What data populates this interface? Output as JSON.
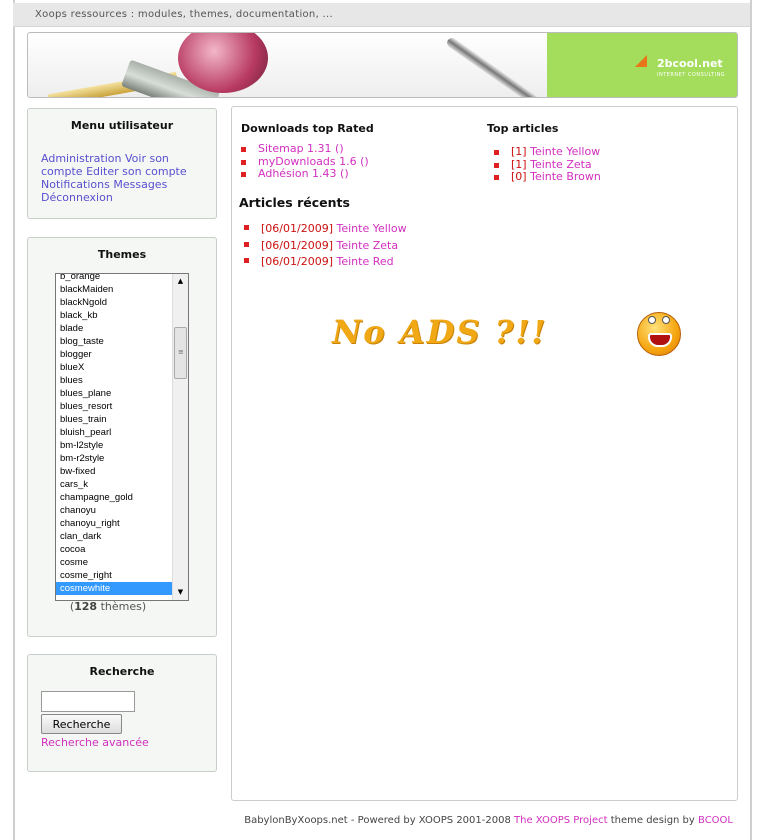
{
  "topbar": {
    "text": "Xoops ressources : modules, themes, documentation, ..."
  },
  "banner": {
    "brand": "2bcool.net",
    "tagline": "INTERNET CONSULTING"
  },
  "user_menu": {
    "title": "Menu utilisateur",
    "links": [
      "Administration",
      "Voir son compte",
      "Editer son compte",
      "Notifications",
      "Messages",
      "Déconnexion"
    ]
  },
  "themes": {
    "title": "Themes",
    "items": [
      "b_orange",
      "blackMaiden",
      "blackNgold",
      "black_kb",
      "blade",
      "blog_taste",
      "blogger",
      "blueX",
      "blues",
      "blues_plane",
      "blues_resort",
      "blues_train",
      "bluish_pearl",
      "bm-l2style",
      "bm-r2style",
      "bw-fixed",
      "cars_k",
      "champagne_gold",
      "chanoyu",
      "chanoyu_right",
      "clan_dark",
      "cocoa",
      "cosme",
      "cosme_right",
      "cosmewhite"
    ],
    "selected": "cosmewhite",
    "count": "128",
    "count_suffix": "thèmes"
  },
  "search": {
    "title": "Recherche",
    "button": "Recherche",
    "advanced": "Recherche avancée",
    "value": ""
  },
  "downloads": {
    "title": "Downloads top Rated",
    "items": [
      {
        "name": "Sitemap 1.31",
        "suffix": "()"
      },
      {
        "name": "myDownloads 1.6",
        "suffix": "()"
      },
      {
        "name": "Adhésion 1.43",
        "suffix": "()"
      }
    ]
  },
  "top_articles": {
    "title": "Top articles",
    "items": [
      {
        "tag": "[1]",
        "name": "Teinte Yellow"
      },
      {
        "tag": "[1]",
        "name": "Teinte Zeta"
      },
      {
        "tag": "[0]",
        "name": "Teinte Brown"
      }
    ]
  },
  "recent_articles": {
    "title": "Articles récents",
    "items": [
      {
        "date": "[06/01/2009]",
        "name": "Teinte Yellow"
      },
      {
        "date": "[06/01/2009]",
        "name": "Teinte Zeta"
      },
      {
        "date": "[06/01/2009]",
        "name": "Teinte Red"
      }
    ]
  },
  "ad": {
    "text": "No ADS ?!!"
  },
  "footer": {
    "text": "BabylonByXoops.net - Powered by XOOPS 2001-2008",
    "link1": "The XOOPS Project",
    "mid": "theme design by",
    "link2": "BCOOL"
  },
  "colors": {
    "link_pink": "#d22fbf",
    "link_purple": "#5a4fcf",
    "bullet_red": "#e02020",
    "banner_green": "#a4dd5c"
  }
}
